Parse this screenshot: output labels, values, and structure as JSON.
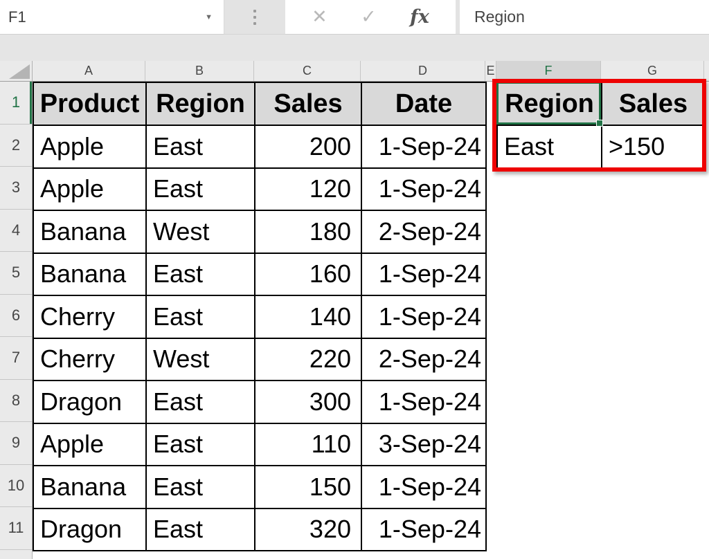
{
  "formula_bar": {
    "name_box_value": "F1",
    "formula_value": "Region",
    "fx_label": "fx",
    "cancel_icon": "✕",
    "enter_icon": "✓",
    "dropdown_icon": "▼"
  },
  "sheet": {
    "column_letters": [
      "A",
      "B",
      "C",
      "D",
      "E",
      "F",
      "G"
    ],
    "row_numbers": [
      "1",
      "2",
      "3",
      "4",
      "5",
      "6",
      "7",
      "8",
      "9",
      "10",
      "11"
    ],
    "selected_column": "F",
    "selected_row": "1",
    "active_cell": "F1"
  },
  "data_table": {
    "headers": [
      "Product",
      "Region",
      "Sales",
      "Date"
    ],
    "rows": [
      [
        "Apple",
        "East",
        "200",
        "1-Sep-24"
      ],
      [
        "Apple",
        "East",
        "120",
        "1-Sep-24"
      ],
      [
        "Banana",
        "West",
        "180",
        "2-Sep-24"
      ],
      [
        "Banana",
        "East",
        "160",
        "1-Sep-24"
      ],
      [
        "Cherry",
        "East",
        "140",
        "1-Sep-24"
      ],
      [
        "Cherry",
        "West",
        "220",
        "2-Sep-24"
      ],
      [
        "Dragon",
        "East",
        "300",
        "1-Sep-24"
      ],
      [
        "Apple",
        "East",
        "110",
        "3-Sep-24"
      ],
      [
        "Banana",
        "East",
        "150",
        "1-Sep-24"
      ],
      [
        "Dragon",
        "East",
        "320",
        "1-Sep-24"
      ]
    ]
  },
  "criteria_table": {
    "headers": [
      "Region",
      "Sales"
    ],
    "rows": [
      [
        "East",
        ">150"
      ]
    ]
  },
  "colors": {
    "selection_green": "#217346",
    "annotation_red": "#ee0202",
    "header_cell_fill": "#d9d9d9"
  }
}
